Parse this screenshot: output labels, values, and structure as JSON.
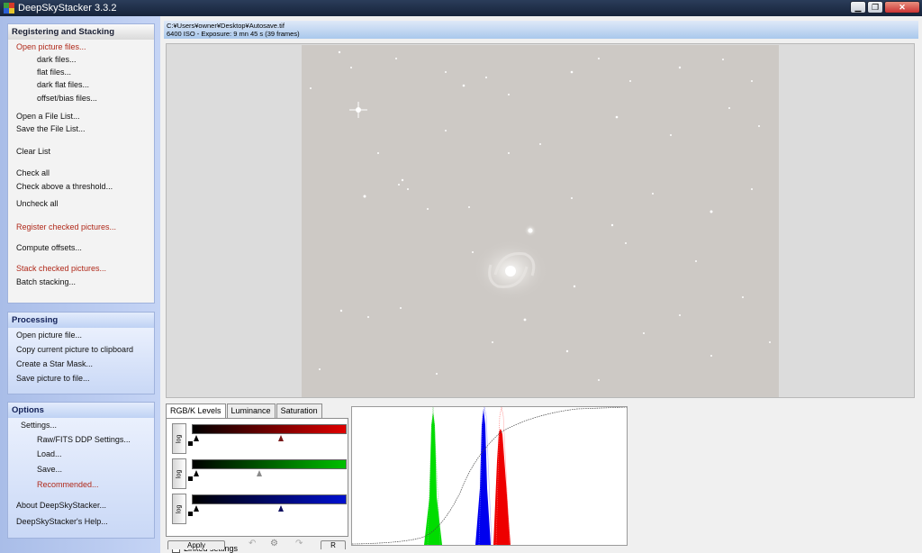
{
  "window": {
    "title": "DeepSkyStacker 3.3.2"
  },
  "colors": {
    "menu_red": "#b0291a",
    "panel_blue": "#a9bde8",
    "infobar_blue": "#a9c8ec"
  },
  "registering": {
    "title": "Registering and Stacking",
    "items": [
      {
        "label": "Open picture files...",
        "red": true,
        "indent": "top"
      },
      {
        "label": "dark files...",
        "indent": "sub"
      },
      {
        "label": "flat files...",
        "indent": "sub"
      },
      {
        "label": "dark flat files...",
        "indent": "sub"
      },
      {
        "label": "offset/bias files...",
        "indent": "sub"
      },
      {
        "label": "Open a File List...",
        "indent": "top"
      },
      {
        "label": "Save the File List...",
        "indent": "top"
      },
      {
        "label": "Clear List",
        "indent": "top"
      },
      {
        "label": "Check all",
        "indent": "top"
      },
      {
        "label": "Check above a threshold...",
        "indent": "top"
      },
      {
        "label": "Uncheck all",
        "indent": "top"
      },
      {
        "label": "Register checked pictures...",
        "red": true,
        "indent": "top"
      },
      {
        "label": "Compute offsets...",
        "indent": "top"
      },
      {
        "label": "Stack checked pictures...",
        "red": true,
        "indent": "top"
      },
      {
        "label": "Batch stacking...",
        "indent": "top"
      }
    ]
  },
  "processing": {
    "title": "Processing",
    "items": [
      {
        "label": "Open picture file..."
      },
      {
        "label": "Copy current picture to clipboard"
      },
      {
        "label": "Create a Star Mask..."
      },
      {
        "label": "Save picture to file..."
      }
    ]
  },
  "options": {
    "title": "Options",
    "items": [
      {
        "label": "Settings...",
        "indent": "sub2"
      },
      {
        "label": "Raw/FITS DDP Settings...",
        "indent": "sub"
      },
      {
        "label": "Load...",
        "indent": "sub"
      },
      {
        "label": "Save...",
        "indent": "sub"
      },
      {
        "label": "Recommended...",
        "red": true,
        "indent": "sub"
      },
      {
        "label": "About DeepSkyStacker...",
        "indent": "top"
      },
      {
        "label": "DeepSkyStacker's Help...",
        "indent": "top"
      }
    ]
  },
  "info": {
    "path": "C:¥Users¥owner¥Desktop¥Autosave.tif",
    "exposure": "6400 ISO - Exposure: 9 mn 45 s (39 frames)"
  },
  "tabs": [
    "RGB/K Levels",
    "Luminance",
    "Saturation"
  ],
  "levels": {
    "log_label": "log",
    "linked_label": "Linked settings",
    "red_mid": 0.58,
    "green_mid": 0.44,
    "blue_mid": 0.58
  },
  "bottom_buttons": [
    "Apply",
    "R"
  ]
}
